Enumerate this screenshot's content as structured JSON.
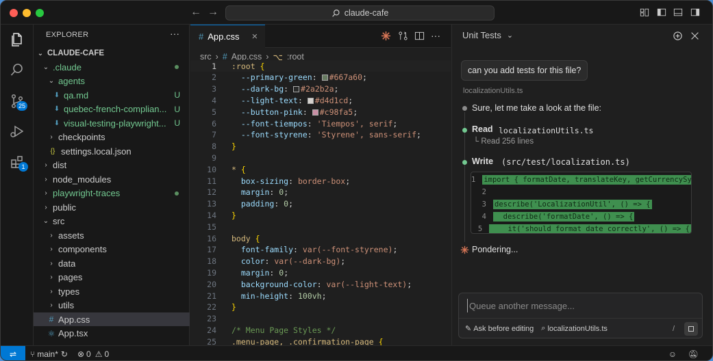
{
  "window": {
    "title": "claude-cafe"
  },
  "activity": {
    "scm_badge": "25",
    "extensions_badge": "1"
  },
  "explorer": {
    "title": "EXPLORER",
    "more": "···",
    "root": "CLAUDE-CAFE",
    "items": [
      {
        "label": ".claude",
        "depth": 1,
        "type": "folder-open",
        "color": "#73c991",
        "marker": "dot"
      },
      {
        "label": "agents",
        "depth": 2,
        "type": "folder-open",
        "color": "#73c991",
        "marker": ""
      },
      {
        "label": "qa.md",
        "depth": 3,
        "type": "file-md",
        "color": "#73c991",
        "marker": "U"
      },
      {
        "label": "quebec-french-complian...",
        "depth": 3,
        "type": "file-md",
        "color": "#73c991",
        "marker": "U"
      },
      {
        "label": "visual-testing-playwright...",
        "depth": 3,
        "type": "file-md",
        "color": "#73c991",
        "marker": "U"
      },
      {
        "label": "checkpoints",
        "depth": 2,
        "type": "folder",
        "color": "#cccccc",
        "marker": ""
      },
      {
        "label": "settings.local.json",
        "depth": 2,
        "type": "file-json",
        "color": "#cccccc",
        "marker": ""
      },
      {
        "label": "dist",
        "depth": 1,
        "type": "folder",
        "color": "#cccccc",
        "marker": ""
      },
      {
        "label": "node_modules",
        "depth": 1,
        "type": "folder",
        "color": "#cccccc",
        "marker": ""
      },
      {
        "label": "playwright-traces",
        "depth": 1,
        "type": "folder",
        "color": "#73c991",
        "marker": "dot"
      },
      {
        "label": "public",
        "depth": 1,
        "type": "folder",
        "color": "#cccccc",
        "marker": ""
      },
      {
        "label": "src",
        "depth": 1,
        "type": "folder-open",
        "color": "#cccccc",
        "marker": ""
      },
      {
        "label": "assets",
        "depth": 2,
        "type": "folder",
        "color": "#cccccc",
        "marker": ""
      },
      {
        "label": "components",
        "depth": 2,
        "type": "folder",
        "color": "#cccccc",
        "marker": ""
      },
      {
        "label": "data",
        "depth": 2,
        "type": "folder",
        "color": "#cccccc",
        "marker": ""
      },
      {
        "label": "pages",
        "depth": 2,
        "type": "folder",
        "color": "#cccccc",
        "marker": ""
      },
      {
        "label": "types",
        "depth": 2,
        "type": "folder",
        "color": "#cccccc",
        "marker": ""
      },
      {
        "label": "utils",
        "depth": 2,
        "type": "folder",
        "color": "#cccccc",
        "marker": ""
      },
      {
        "label": "App.css",
        "depth": 2,
        "type": "file-css",
        "color": "#cccccc",
        "marker": "",
        "selected": true
      },
      {
        "label": "App.tsx",
        "depth": 2,
        "type": "file-tsx",
        "color": "#cccccc",
        "marker": ""
      }
    ]
  },
  "editor": {
    "tab_label": "App.css",
    "tab_close": "×",
    "breadcrumb": [
      "src",
      "App.css",
      ":root"
    ],
    "lines": [
      {
        "n": "1",
        "tokens": [
          [
            ":root",
            "k"
          ],
          [
            " {",
            "b"
          ]
        ]
      },
      {
        "n": "2",
        "tokens": [
          [
            "  --primary-green",
            "p"
          ],
          [
            ": ",
            "s"
          ],
          [
            "SW#667a60",
            "v"
          ],
          [
            ";",
            "s"
          ]
        ]
      },
      {
        "n": "3",
        "tokens": [
          [
            "  --dark-bg",
            "p"
          ],
          [
            ": ",
            "s"
          ],
          [
            "SW#2a2b2a",
            "v"
          ],
          [
            ";",
            "s"
          ]
        ]
      },
      {
        "n": "4",
        "tokens": [
          [
            "  --light-text",
            "p"
          ],
          [
            ": ",
            "s"
          ],
          [
            "SW#d4d1cd",
            "v"
          ],
          [
            ";",
            "s"
          ]
        ]
      },
      {
        "n": "5",
        "tokens": [
          [
            "  --button-pink",
            "p"
          ],
          [
            ": ",
            "s"
          ],
          [
            "SW#c98fa5",
            "v"
          ],
          [
            ";",
            "s"
          ]
        ]
      },
      {
        "n": "6",
        "tokens": [
          [
            "  --font-tiempos",
            "p"
          ],
          [
            ": ",
            "s"
          ],
          [
            "'Tiempos', serif",
            "v"
          ],
          [
            ";",
            "s"
          ]
        ]
      },
      {
        "n": "7",
        "tokens": [
          [
            "  --font-styrene",
            "p"
          ],
          [
            ": ",
            "s"
          ],
          [
            "'Styrene', sans-serif",
            "v"
          ],
          [
            ";",
            "s"
          ]
        ]
      },
      {
        "n": "8",
        "tokens": [
          [
            "}",
            "b"
          ]
        ]
      },
      {
        "n": "9",
        "tokens": []
      },
      {
        "n": "10",
        "tokens": [
          [
            "*",
            "k"
          ],
          [
            " {",
            "b"
          ]
        ]
      },
      {
        "n": "11",
        "tokens": [
          [
            "  box-sizing",
            "p"
          ],
          [
            ": ",
            "s"
          ],
          [
            "border-box",
            "v"
          ],
          [
            ";",
            "s"
          ]
        ]
      },
      {
        "n": "12",
        "tokens": [
          [
            "  margin",
            "p"
          ],
          [
            ": ",
            "s"
          ],
          [
            "0",
            "n"
          ],
          [
            ";",
            "s"
          ]
        ]
      },
      {
        "n": "13",
        "tokens": [
          [
            "  padding",
            "p"
          ],
          [
            ": ",
            "s"
          ],
          [
            "0",
            "n"
          ],
          [
            ";",
            "s"
          ]
        ]
      },
      {
        "n": "14",
        "tokens": [
          [
            "}",
            "b"
          ]
        ]
      },
      {
        "n": "15",
        "tokens": []
      },
      {
        "n": "16",
        "tokens": [
          [
            "body",
            "k"
          ],
          [
            " {",
            "b"
          ]
        ]
      },
      {
        "n": "17",
        "tokens": [
          [
            "  font-family",
            "p"
          ],
          [
            ": ",
            "s"
          ],
          [
            "var(--font-styrene)",
            "v"
          ],
          [
            ";",
            "s"
          ]
        ]
      },
      {
        "n": "18",
        "tokens": [
          [
            "  color",
            "p"
          ],
          [
            ": ",
            "s"
          ],
          [
            "var(--dark-bg)",
            "v"
          ],
          [
            ";",
            "s"
          ]
        ]
      },
      {
        "n": "19",
        "tokens": [
          [
            "  margin",
            "p"
          ],
          [
            ": ",
            "s"
          ],
          [
            "0",
            "n"
          ],
          [
            ";",
            "s"
          ]
        ]
      },
      {
        "n": "20",
        "tokens": [
          [
            "  background-color",
            "p"
          ],
          [
            ": ",
            "s"
          ],
          [
            "var(--light-text)",
            "v"
          ],
          [
            ";",
            "s"
          ]
        ]
      },
      {
        "n": "21",
        "tokens": [
          [
            "  min-height",
            "p"
          ],
          [
            ": ",
            "s"
          ],
          [
            "100vh",
            "n"
          ],
          [
            ";",
            "s"
          ]
        ]
      },
      {
        "n": "22",
        "tokens": [
          [
            "}",
            "b"
          ]
        ]
      },
      {
        "n": "23",
        "tokens": []
      },
      {
        "n": "24",
        "tokens": [
          [
            "/* Menu Page Styles */",
            "c"
          ]
        ]
      },
      {
        "n": "25",
        "tokens": [
          [
            ".menu-page, .confirmation-page",
            "k"
          ],
          [
            " {",
            "b"
          ]
        ]
      }
    ]
  },
  "panel": {
    "title": "Unit Tests",
    "user_message": "can you add tests for this file?",
    "file_ref": "localizationUtils.ts",
    "step1_text": "Sure, let me take a look at the file:",
    "step2_verb": "Read",
    "step2_arg": "localizationUtils.ts",
    "step2_detail": "└ Read 256 lines",
    "step3_verb": "Write",
    "step3_arg": "(src/test/localization.ts)",
    "code_lines": [
      {
        "n": "1",
        "text": "import { formatDate, translateKey, getCurrencySymbol } from",
        "added": true
      },
      {
        "n": "2",
        "text": "",
        "added": false
      },
      {
        "n": "3",
        "text": "describe('LocalizationUtil', () => {",
        "added": true
      },
      {
        "n": "4",
        "text": "  describe('formatDate', () => {",
        "added": true
      },
      {
        "n": "5",
        "text": "    it('should format date correctly', () => {",
        "added": true
      }
    ],
    "thinking": "Pondering...",
    "input_placeholder": "Queue another message...",
    "mode_label": "Ask before editing",
    "context_file": "localizationUtils.ts",
    "slash": "/"
  },
  "status": {
    "branch": "main*",
    "errors": "0",
    "warnings": "0"
  },
  "colors": {
    "accent": "#0078d4",
    "git_added": "#73c991",
    "diff_add_bg": "#3f8f4f",
    "claude_orange": "#d97757"
  }
}
